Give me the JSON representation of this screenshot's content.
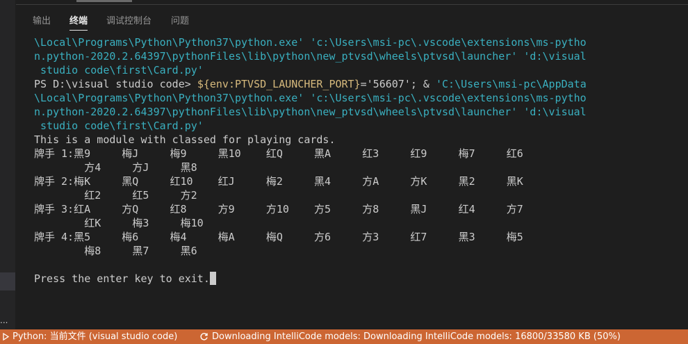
{
  "tabs": [
    {
      "label": "输出"
    },
    {
      "label": "终端"
    },
    {
      "label": "调试控制台"
    },
    {
      "label": "问题"
    }
  ],
  "terminal": {
    "lines": [
      [
        {
          "t": "\\Local\\Programs\\Python\\Python37\\python.exe' 'c:\\Users\\msi-pc\\.vscode\\extensions\\ms-pytho",
          "c": "c-path"
        }
      ],
      [
        {
          "t": "n.python-2020.2.64397\\pythonFiles\\lib\\python\\new_ptvsd\\wheels\\ptvsd\\launcher' 'd:\\visual",
          "c": "c-path"
        }
      ],
      [
        {
          "t": " studio code\\first\\Card.py'",
          "c": "c-path"
        }
      ],
      [
        {
          "t": "PS D:\\visual studio code> ",
          "c": "c-str"
        },
        {
          "t": "${env:PTVSD_LAUNCHER_PORT}",
          "c": "c-yellow"
        },
        {
          "t": "='56607'; & ",
          "c": "c-str"
        },
        {
          "t": "'C:\\Users\\msi-pc\\AppData",
          "c": "c-cyan"
        }
      ],
      [
        {
          "t": "\\Local\\Programs\\Python\\Python37\\python.exe' 'c:\\Users\\msi-pc\\.vscode\\extensions\\ms-pytho",
          "c": "c-path"
        }
      ],
      [
        {
          "t": "n.python-2020.2.64397\\pythonFiles\\lib\\python\\new_ptvsd\\wheels\\ptvsd\\launcher' 'd:\\visual",
          "c": "c-path"
        }
      ],
      [
        {
          "t": " studio code\\first\\Card.py'",
          "c": "c-path"
        }
      ],
      [
        {
          "t": "This is a module with classed for playing cards.",
          "c": "c-str"
        }
      ],
      [
        {
          "t": "牌手 1:黑9     梅J     梅9     黑10    红Q     黑A     红3     红9     梅7     红6",
          "c": "c-str"
        }
      ],
      [
        {
          "t": "        方4     方J     黑8",
          "c": "c-str"
        }
      ],
      [
        {
          "t": "牌手 2:梅K     黑Q     红10    红J     梅2     黑4     方A     方K     黑2     黑K",
          "c": "c-str"
        }
      ],
      [
        {
          "t": "        红2     红5     方2",
          "c": "c-str"
        }
      ],
      [
        {
          "t": "牌手 3:红A     方Q     红8     方9     方10    方5     方8     黑J     红4     方7",
          "c": "c-str"
        }
      ],
      [
        {
          "t": "        红K     梅3     梅10",
          "c": "c-str"
        }
      ],
      [
        {
          "t": "牌手 4:黑5     梅6     梅4     梅A     梅Q     方6     方3     红7     黑3     梅5",
          "c": "c-str"
        }
      ],
      [
        {
          "t": "        梅8     黑7     黑6",
          "c": "c-str"
        }
      ],
      [
        {
          "t": "",
          "c": "c-str"
        }
      ],
      [
        {
          "t": "Press the enter key to exit.",
          "c": "c-str"
        }
      ]
    ]
  },
  "status": {
    "python": "Python: 当前文件 (visual studio code)",
    "download": "Downloading IntelliCode models: Downloading IntelliCode models: 16800/33580 KB (50%)",
    "bg_color": "#cc6633"
  },
  "left": {
    "dots": "..."
  }
}
